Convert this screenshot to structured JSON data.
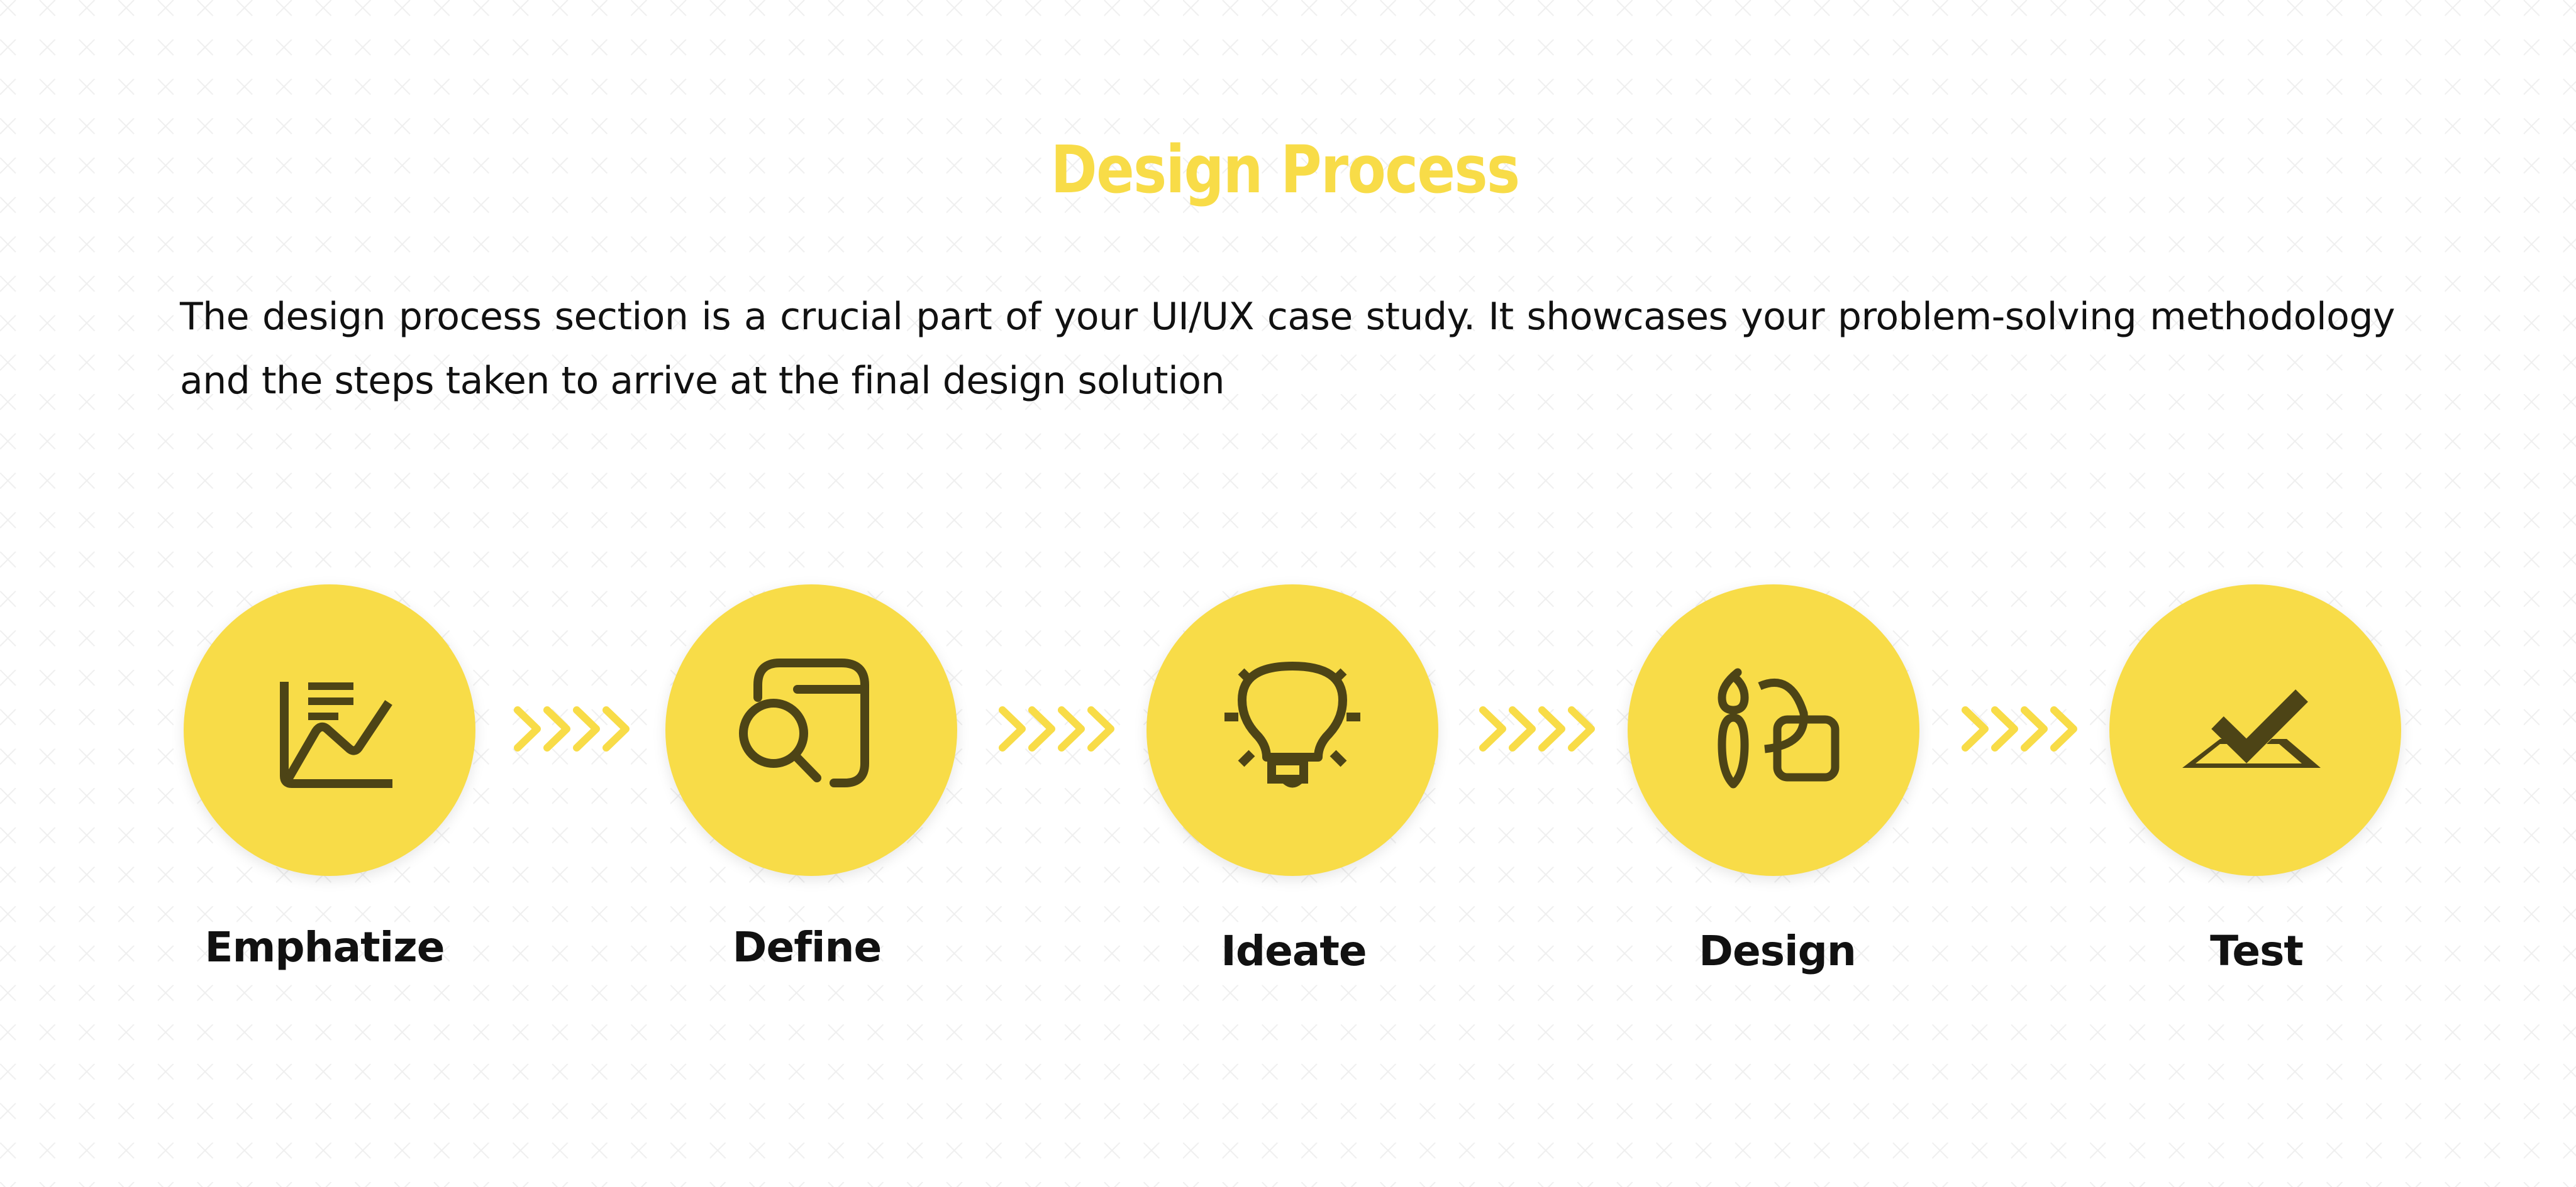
{
  "colors": {
    "accent": "#f8dc48",
    "icon": "#4d4416",
    "text": "#111111",
    "pattern": "#eeeeee"
  },
  "header": {
    "title": "Design Process"
  },
  "description": {
    "line1": "The design process section is a crucial part of your UI/UX case study. It showcases your problem-solving methodology",
    "line2": "and the steps taken to arrive at the final design solution"
  },
  "steps": [
    {
      "label": "Emphatize",
      "icon": "chart-analysis-icon"
    },
    {
      "label": "Define",
      "icon": "browser-search-icon"
    },
    {
      "label": "Ideate",
      "icon": "lightbulb-icon"
    },
    {
      "label": "Design",
      "icon": "brush-shapes-icon"
    },
    {
      "label": "Test",
      "icon": "checkmark-tray-icon"
    }
  ],
  "connectors": [
    {
      "icon": "chevrons-right-icon",
      "count": 4
    },
    {
      "icon": "chevrons-right-icon",
      "count": 4
    },
    {
      "icon": "chevrons-right-icon",
      "count": 4
    },
    {
      "icon": "chevrons-right-icon",
      "count": 4
    }
  ]
}
